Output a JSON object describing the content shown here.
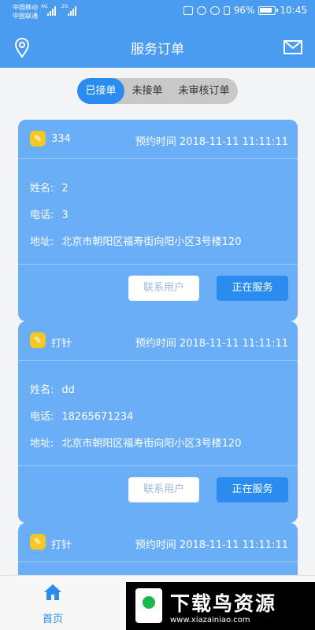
{
  "status_bar": {
    "carrier_1": "中国移动",
    "carrier_2": "中国联通",
    "net_1": "4G",
    "net_2": "2G",
    "battery": "96%",
    "time": "10:45"
  },
  "header": {
    "title": "服务订单",
    "left_icon": "location-pin-icon",
    "right_icon": "mail-icon"
  },
  "tabs": [
    {
      "label": "已接单",
      "active": true
    },
    {
      "label": "未接单",
      "active": false
    },
    {
      "label": "未审核订单",
      "active": false
    }
  ],
  "labels": {
    "time_prefix": "预约时间",
    "name": "姓名:",
    "phone": "电话:",
    "address": "地址:",
    "contact_button": "联系用户",
    "status_button": "正在服务"
  },
  "orders": [
    {
      "service": "334",
      "time": "2018-11-11 11:11:11",
      "name": "2",
      "phone": "3",
      "address": "北京市朝阳区福寿街向阳小区3号楼120"
    },
    {
      "service": "打针",
      "time": "2018-11-11 11:11:11",
      "name": "dd",
      "phone": "18265671234",
      "address": "北京市朝阳区福寿街向阳小区3号楼120"
    },
    {
      "service": "打针",
      "time": "2018-11-11 11:11:11"
    }
  ],
  "bottom_nav": {
    "home_label": "首页",
    "home_icon": "home-icon"
  },
  "watermark": {
    "title": "下载鸟资源",
    "url": "www.xiazainiao.com"
  },
  "colors": {
    "primary": "#4a9cf0",
    "card": "#6aaef8",
    "button": "#2b8cf0",
    "service_icon": "#f5c829"
  }
}
